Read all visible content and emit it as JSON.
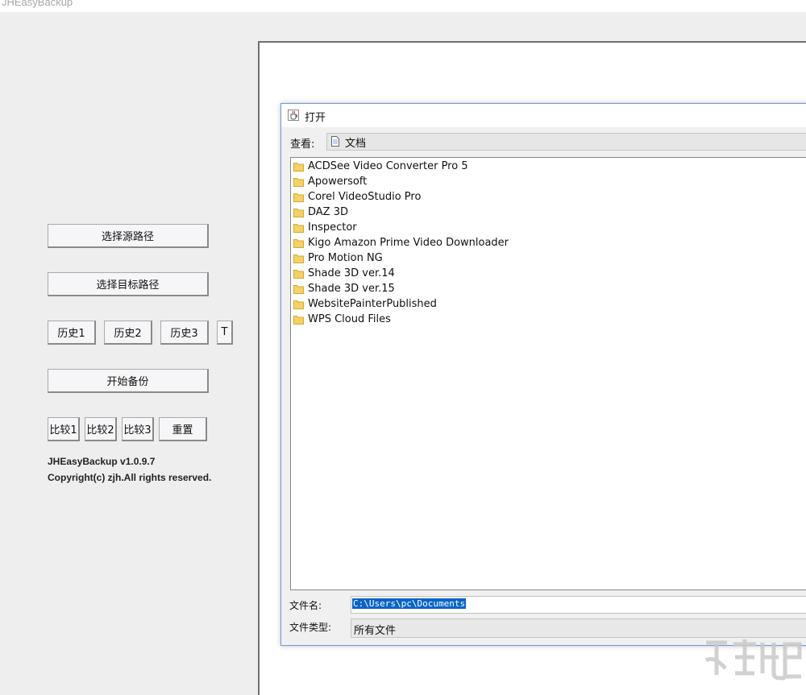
{
  "app": {
    "title": "JHEasyBackup"
  },
  "buttons": {
    "select_source": "选择源路径",
    "select_target": "选择目标路径",
    "history1": "历史1",
    "history2": "历史2",
    "history3": "历史3",
    "t": "T",
    "start_backup": "开始备份",
    "compare1": "比较1",
    "compare2": "比较2",
    "compare3": "比较3",
    "reset": "重置"
  },
  "info": {
    "version": "JHEasyBackup v1.0.9.7",
    "copyright": "Copyright(c) zjh.All rights reserved."
  },
  "dialog": {
    "title": "打开",
    "look_in_label": "查看:",
    "look_in_value": "文档",
    "items": [
      "ACDSee Video Converter Pro 5",
      "Apowersoft",
      "Corel VideoStudio Pro",
      "DAZ 3D",
      "Inspector",
      "Kigo Amazon Prime Video Downloader",
      "Pro Motion NG",
      "Shade 3D ver.14",
      "Shade 3D ver.15",
      "WebsitePainterPublished",
      "WPS Cloud Files"
    ],
    "filename_label": "文件名:",
    "filename_value": "C:\\Users\\pc\\Documents",
    "filetype_label": "文件类型:",
    "filetype_value": "所有文件"
  },
  "colors": {
    "selection": "#0a64c8",
    "folder": "#f4d26a",
    "dialog_border": "#6f9ad6"
  }
}
